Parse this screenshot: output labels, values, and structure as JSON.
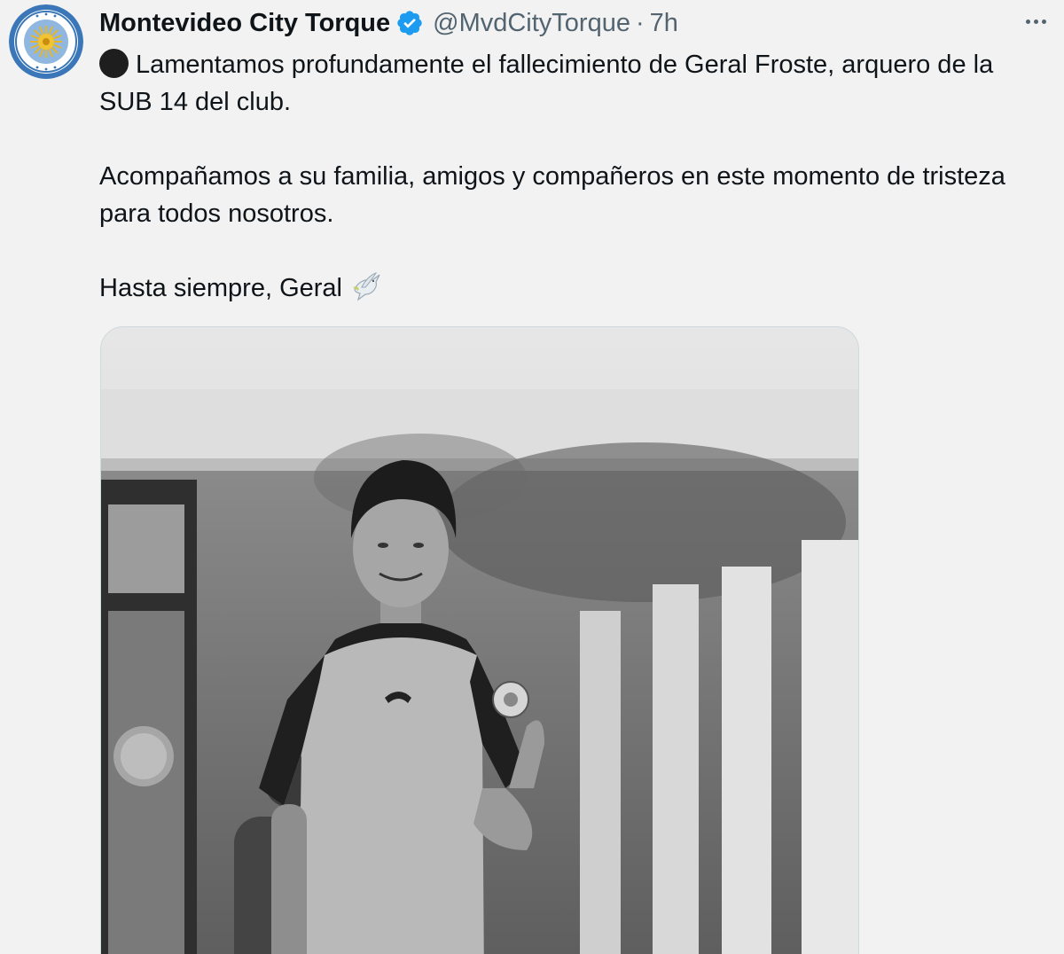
{
  "tweet": {
    "display_name": "Montevideo City Torque",
    "handle": "@MvdCityTorque",
    "separator": "·",
    "time": "7h",
    "verified": true,
    "avatar_icon": "club-crest-icon",
    "more_icon": "more-options-icon",
    "body": {
      "line1_emoji": "black-circle-icon",
      "line1": "Lamentamos profundamente el fallecimiento de Geral Froste, arquero de la SUB 14 del club.",
      "line2": "Acompañamos a su familia, amigos y compañeros en este momento de tristeza para todos nosotros.",
      "line3": "Hasta siempre, Geral",
      "line3_emoji": "dove-icon"
    },
    "media": {
      "kind": "photo",
      "alt_icon": "player-photo"
    }
  },
  "colors": {
    "background": "#f2f2f2",
    "text": "#0f1419",
    "secondary_text": "#536471",
    "verified_blue": "#1d9bf0",
    "crest_blue": "#3b77b8"
  }
}
